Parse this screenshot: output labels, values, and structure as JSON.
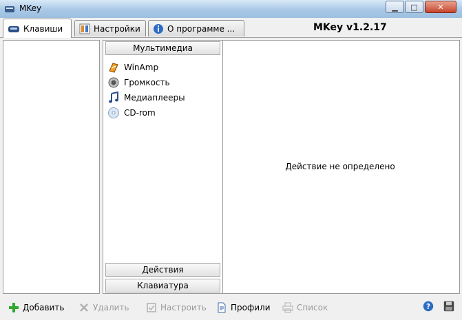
{
  "window": {
    "title": "MKey"
  },
  "tabs": [
    {
      "label": "Клавиши"
    },
    {
      "label": "Настройки"
    },
    {
      "label": "О программе ..."
    }
  ],
  "version": "MKey v1.2.17",
  "groups": {
    "multimedia": "Мультимедиа",
    "actions": "Действия",
    "keyboard": "Клавиатура"
  },
  "multimedia_items": [
    {
      "label": "WinAmp",
      "icon": "winamp-icon"
    },
    {
      "label": "Громкость",
      "icon": "speaker-icon"
    },
    {
      "label": "Медиаплееры",
      "icon": "music-note-icon"
    },
    {
      "label": "CD-rom",
      "icon": "cd-icon"
    }
  ],
  "action_message": "Действие не определено",
  "toolbar": {
    "add": "Добавить",
    "delete": "Удалить",
    "configure": "Настроить",
    "profiles": "Профили",
    "list": "Список"
  },
  "colors": {
    "add_green": "#2eaa2e",
    "help_blue": "#2d6cc4",
    "disabled_text": "#9a9a9a"
  }
}
